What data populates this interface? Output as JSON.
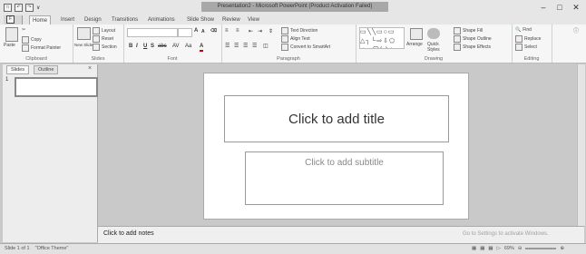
{
  "window": {
    "title": "Presentation2 - Microsoft PowerPoint (Product Activation Failed)",
    "minimize": "–",
    "maximize": "□",
    "close": "✕"
  },
  "qat": {
    "save_icon": "save-icon",
    "undo_icon": "undo-icon",
    "redo_icon": "redo-icon",
    "customize": "∨"
  },
  "tabs": [
    {
      "label": "",
      "key": "F"
    },
    {
      "label": "Home",
      "key": "H"
    },
    {
      "label": "Insert",
      "key": "N"
    },
    {
      "label": "Design",
      "key": "G"
    },
    {
      "label": "Transitions",
      "key": "K"
    },
    {
      "label": "Animations",
      "key": "A"
    },
    {
      "label": "Slide Show",
      "key": "S"
    },
    {
      "label": "Review",
      "key": "R"
    },
    {
      "label": "View",
      "key": "W"
    }
  ],
  "ribbon": {
    "clipboard": {
      "label": "Clipboard",
      "paste": "Paste",
      "cut": "",
      "copy": "Copy",
      "format_painter": "Format Painter"
    },
    "slides": {
      "label": "Slides",
      "new_slide": "New Slide",
      "layout": "Layout",
      "reset": "Reset",
      "section": "Section"
    },
    "font": {
      "label": "Font",
      "grow": "A",
      "shrink": "A",
      "clear": "Aa",
      "bold": "B",
      "italic": "I",
      "underline": "U",
      "strike": "S",
      "abc": "abc",
      "spacing": "AV",
      "case": "Aa",
      "color": "A"
    },
    "paragraph": {
      "label": "Paragraph",
      "text_direction": "Text Direction",
      "align_text": "Align Text",
      "smartart": "Convert to SmartArt"
    },
    "drawing": {
      "label": "Drawing",
      "arrange": "Arrange",
      "quick_styles": "Quick Styles",
      "shape_fill": "Shape Fill",
      "shape_outline": "Shape Outline",
      "shape_effects": "Shape Effects",
      "shapes": "▭╲╲▭○▭ △┐└⇨⇩⬠ ↗↘⌒{ }☆"
    },
    "editing": {
      "label": "Editing",
      "find": "Find",
      "replace": "Replace",
      "select": "Select"
    }
  },
  "panel": {
    "tab_slides": "Slides",
    "tab_outline": "Outline",
    "close": "×",
    "slide_number": "1"
  },
  "slide": {
    "title_placeholder": "Click to add title",
    "subtitle_placeholder": "Click to add subtitle"
  },
  "notes": {
    "placeholder": "Click to add notes"
  },
  "watermark": {
    "line2": "Go to Settings to activate Windows."
  },
  "status": {
    "slide_info": "Slide 1 of 1",
    "theme": "\"Office Theme\"",
    "zoom": "69%"
  }
}
